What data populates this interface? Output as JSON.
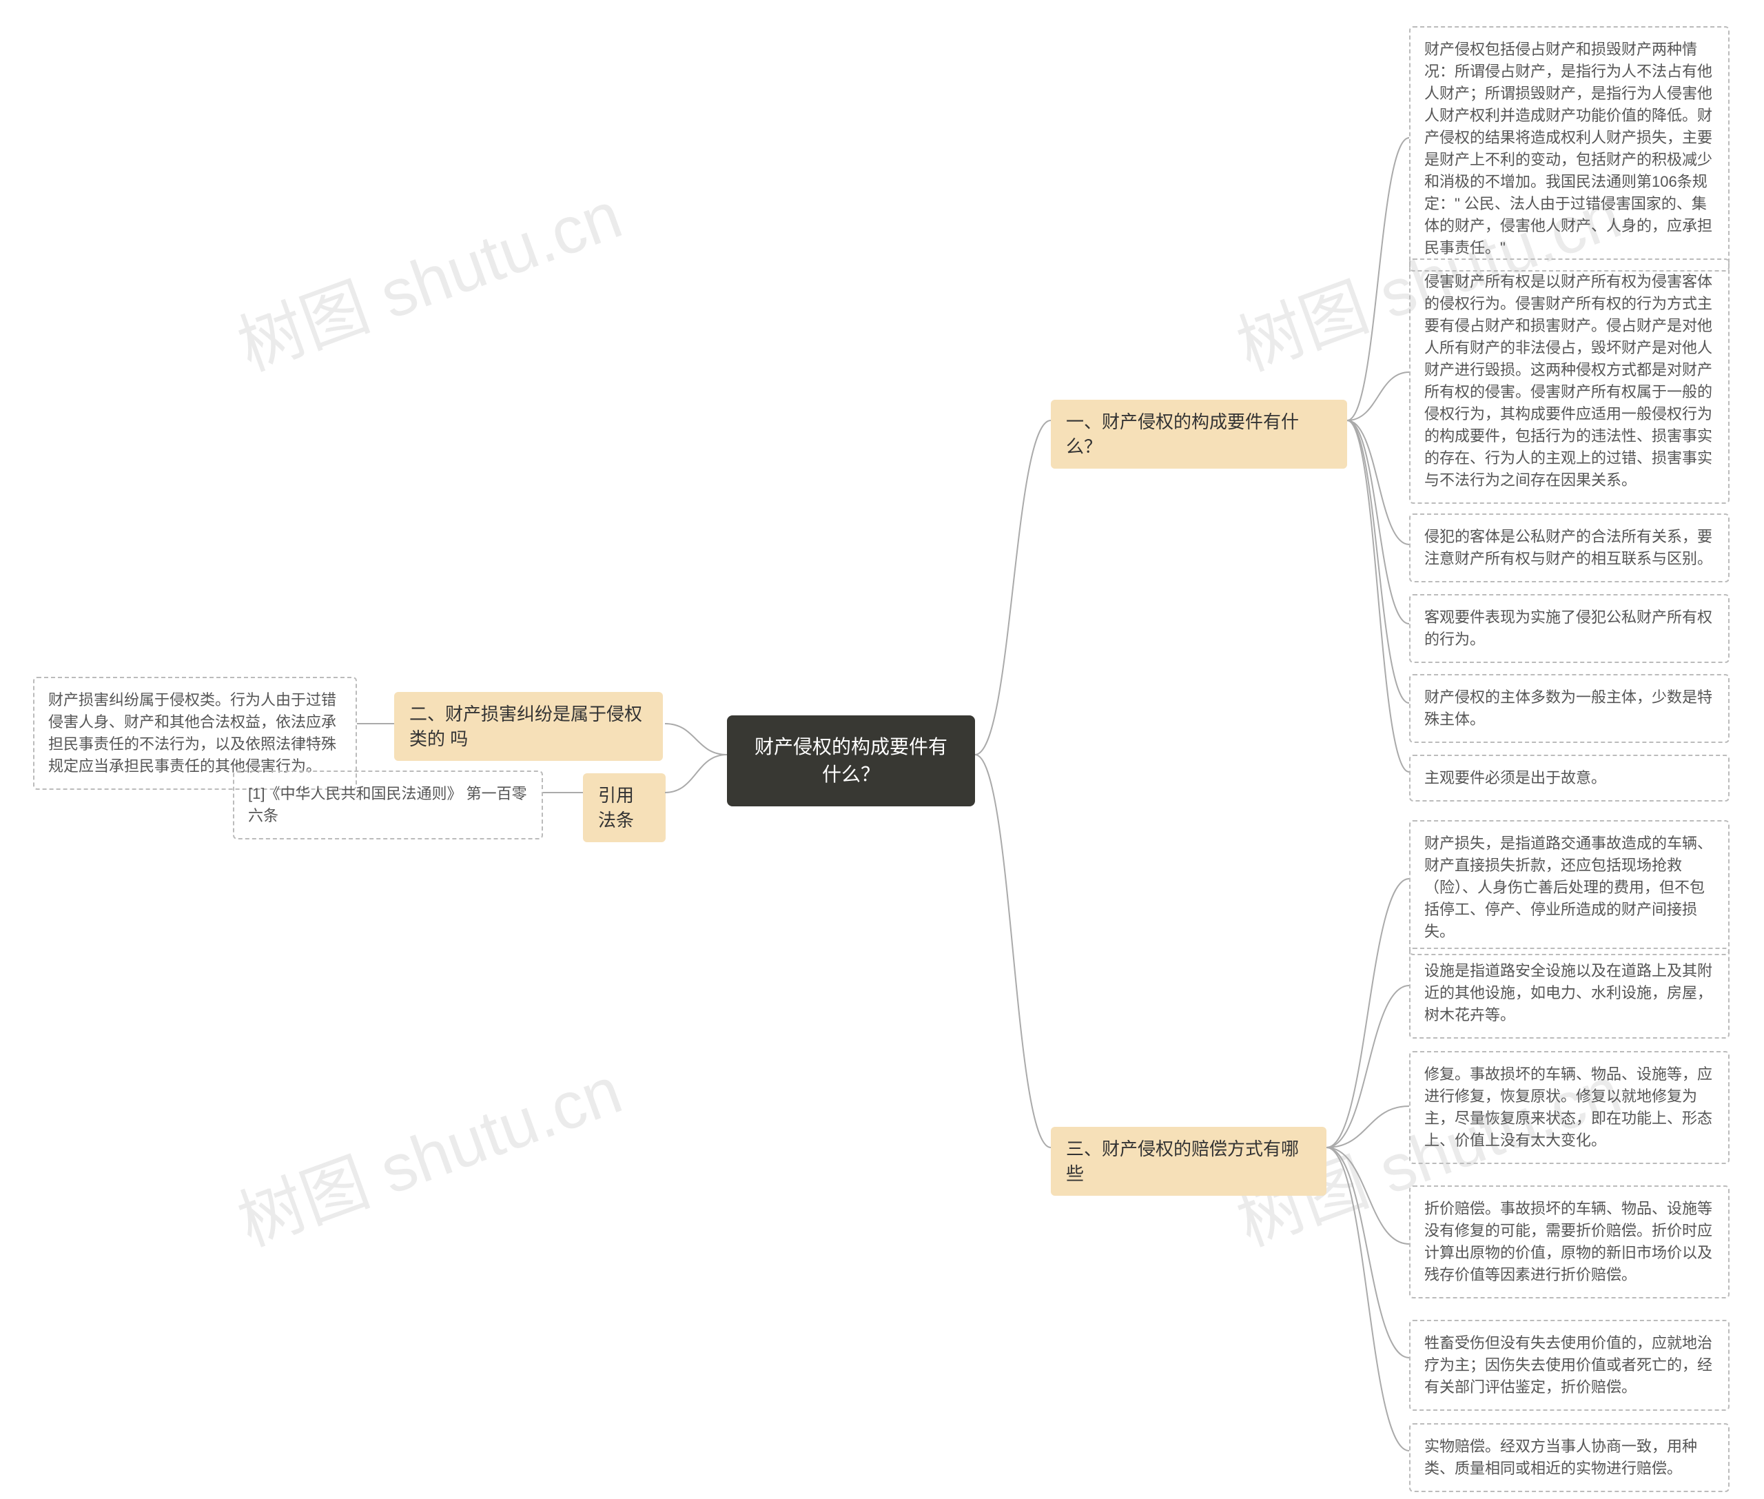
{
  "center": {
    "title": "财产侵权的构成要件有什么？"
  },
  "branches": {
    "r1": {
      "label": "一、财产侵权的构成要件有什么？"
    },
    "r2": {
      "label": "三、财产侵权的赔偿方式有哪些"
    },
    "l1": {
      "label": "二、财产损害纠纷是属于侵权类的\n吗"
    },
    "l2": {
      "label": "引用法条"
    }
  },
  "leaves": {
    "r1a": "财产侵权包括侵占财产和损毁财产两种情况：所谓侵占财产，是指行为人不法占有他人财产；所谓损毁财产，是指行为人侵害他人财产权利并造成财产功能价值的降低。财产侵权的结果将造成权利人财产损失，主要是财产上不利的变动，包括财产的积极减少和消极的不增加。我国民法通则第106条规定：\" 公民、法人由于过错侵害国家的、集体的财产，侵害他人财产、人身的，应承担民事责任。\"",
    "r1b": "侵害财产所有权是以财产所有权为侵害客体的侵权行为。侵害财产所有权的行为方式主要有侵占财产和损害财产。侵占财产是对他人所有财产的非法侵占，毁坏财产是对他人财产进行毁损。这两种侵权方式都是对财产所有权的侵害。侵害财产所有权属于一般的侵权行为，其构成要件应适用一般侵权行为的构成要件，包括行为的违法性、损害事实的存在、行为人的主观上的过错、损害事实与不法行为之间存在因果关系。",
    "r1c": "侵犯的客体是公私财产的合法所有关系，要注意财产所有权与财产的相互联系与区别。",
    "r1d": "客观要件表现为实施了侵犯公私财产所有权的行为。",
    "r1e": "财产侵权的主体多数为一般主体，少数是特殊主体。",
    "r1f": "主观要件必须是出于故意。",
    "r2a": "财产损失，是指道路交通事故造成的车辆、财产直接损失折款，还应包括现场抢救（险）、人身伤亡善后处理的费用，但不包括停工、停产、停业所造成的财产间接损失。",
    "r2b": "设施是指道路安全设施以及在道路上及其附近的其他设施，如电力、水利设施，房屋，树木花卉等。",
    "r2c": "修复。事故损坏的车辆、物品、设施等，应进行修复，恢复原状。修复以就地修复为主，尽量恢复原来状态，即在功能上、形态上、价值上没有太大变化。",
    "r2d": "折价赔偿。事故损坏的车辆、物品、设施等没有修复的可能，需要折价赔偿。折价时应计算出原物的价值，原物的新旧市场价以及残存价值等因素进行折价赔偿。",
    "r2e": "牲畜受伤但没有失去使用价值的，应就地治疗为主；因伤失去使用价值或者死亡的，经有关部门评估鉴定，折价赔偿。",
    "r2f": "实物赔偿。经双方当事人协商一致，用种类、质量相同或相近的实物进行赔偿。",
    "l1a": "财产损害纠纷属于侵权类。行为人由于过错侵害人身、财产和其他合法权益，依法应承担民事责任的不法行为，以及依照法律特殊规定应当承担民事责任的其他侵害行为。",
    "l2a": "[1]《中华人民共和国民法通则》 第一百零六条"
  },
  "watermarks": {
    "wm1": "树图 shutu.cn",
    "wm2": "树图 shutu.cn",
    "wm3": "树图 shutu.cn",
    "wm4": "树图 shutu.cn"
  }
}
